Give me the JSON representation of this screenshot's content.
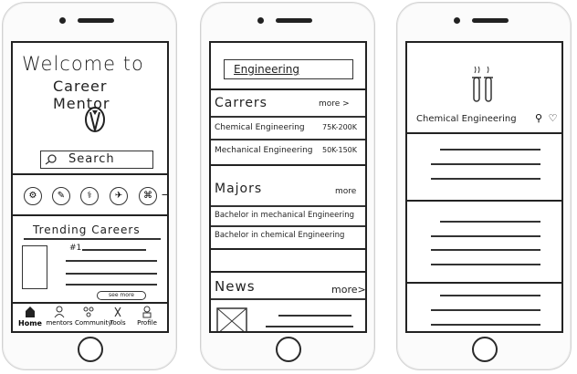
{
  "screen1": {
    "welcome": "Welcome to",
    "app_name": "Career Mentor",
    "search_label": "Search",
    "trending_title": "Trending Careers",
    "trending_rank": "#1",
    "see_more": "see more",
    "nav": [
      {
        "label": "Home",
        "icon": "home-icon"
      },
      {
        "label": "mentors",
        "icon": "mentors-icon"
      },
      {
        "label": "Community",
        "icon": "community-icon"
      },
      {
        "label": "Tools",
        "icon": "tools-icon"
      },
      {
        "label": "Profile",
        "icon": "profile-icon"
      }
    ]
  },
  "screen2": {
    "search_value": "Engineering",
    "careers_title": "Carrers",
    "careers_more": "more >",
    "careers": [
      {
        "name": "Chemical Engineering",
        "salary": "75K-200K"
      },
      {
        "name": "Mechanical Engineering",
        "salary": "50K-150K"
      }
    ],
    "majors_title": "Majors",
    "majors_more": "more",
    "majors": [
      "Bachelor in mechanical Engineering",
      "Bachelor in chemical Engineering"
    ],
    "news_title": "News",
    "news_more": "more>"
  },
  "screen3": {
    "title": "Chemical Engineering",
    "icons": [
      "share-icon",
      "heart-icon"
    ]
  }
}
